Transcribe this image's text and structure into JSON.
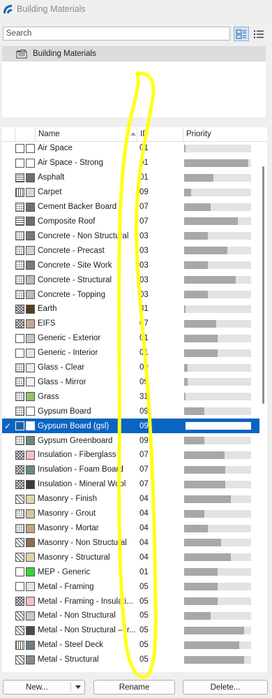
{
  "window": {
    "title": "Building Materials",
    "accent_color": "#0a64c3"
  },
  "search": {
    "placeholder": "Search",
    "value": ""
  },
  "toolbar": {
    "icons": [
      "tree-view-icon",
      "list-view-icon"
    ]
  },
  "tree": {
    "item_label": "Building Materials",
    "icon": "folder-icon"
  },
  "table": {
    "columns": {
      "name": "Name",
      "id": "ID",
      "priority": "Priority"
    },
    "sort": {
      "column": "name",
      "direction": "ascending"
    },
    "rows": [
      {
        "name": "Air Space",
        "id": "01",
        "priority": 0.02,
        "pattern": "none",
        "color": "#ffffff"
      },
      {
        "name": "Air Space - Strong",
        "id": "01",
        "priority": 0.96,
        "pattern": "none",
        "color": "#ffffff"
      },
      {
        "name": "Asphalt",
        "id": "01",
        "priority": 0.44,
        "pattern": "hlines",
        "color": "#6e6e6e"
      },
      {
        "name": "Carpet",
        "id": "09",
        "priority": 0.1,
        "pattern": "vlines",
        "color": "#d8d8d8"
      },
      {
        "name": "Cement Backer Board",
        "id": "07",
        "priority": 0.4,
        "pattern": "dots",
        "color": "#727272"
      },
      {
        "name": "Composite Roof",
        "id": "07",
        "priority": 0.8,
        "pattern": "hlines",
        "color": "#6e6e6e"
      },
      {
        "name": "Concrete - Non Structural",
        "id": "03",
        "priority": 0.35,
        "pattern": "dots",
        "color": "#7a7a7a"
      },
      {
        "name": "Concrete - Precast",
        "id": "03",
        "priority": 0.65,
        "pattern": "dots",
        "color": "#d2d2d2"
      },
      {
        "name": "Concrete - Site Work",
        "id": "03",
        "priority": 0.35,
        "pattern": "dots",
        "color": "#7a7a7a"
      },
      {
        "name": "Concrete - Structural",
        "id": "03",
        "priority": 0.77,
        "pattern": "dots",
        "color": "#bdbdbd"
      },
      {
        "name": "Concrete - Topping",
        "id": "03",
        "priority": 0.35,
        "pattern": "dots",
        "color": "#bdbdbd"
      },
      {
        "name": "Earth",
        "id": "31",
        "priority": 0.02,
        "pattern": "cross",
        "color": "#5a3d1e"
      },
      {
        "name": "EIFS",
        "id": "07",
        "priority": 0.48,
        "pattern": "cross",
        "color": "#c8a890"
      },
      {
        "name": "Generic - Exterior",
        "id": "01",
        "priority": 0.5,
        "pattern": "none",
        "color": "#c8c8c8"
      },
      {
        "name": "Generic - Interior",
        "id": "01",
        "priority": 0.5,
        "pattern": "none",
        "color": "#e6e6e6"
      },
      {
        "name": "Glass - Clear",
        "id": "09",
        "priority": 0.05,
        "pattern": "dots",
        "color": "#e6f2f6"
      },
      {
        "name": "Glass - Mirror",
        "id": "09",
        "priority": 0.05,
        "pattern": "dots",
        "color": "#eef6ee"
      },
      {
        "name": "Grass",
        "id": "31",
        "priority": 0.02,
        "pattern": "dots",
        "color": "#8fc56b"
      },
      {
        "name": "Gypsum Board",
        "id": "09",
        "priority": 0.3,
        "pattern": "dots",
        "color": "#ffffff"
      },
      {
        "name": "Gypsum Board (gsl)",
        "id": "09",
        "priority": 0.02,
        "pattern": "dots",
        "color": "#ffffff",
        "selected": true,
        "checked": true
      },
      {
        "name": "Gypsum Greenboard",
        "id": "09",
        "priority": 0.3,
        "pattern": "dots",
        "color": "#6f8a74"
      },
      {
        "name": "Insulation - Fiberglass",
        "id": "07",
        "priority": 0.6,
        "pattern": "cross",
        "color": "#f4c0c4"
      },
      {
        "name": "Insulation - Foam Board",
        "id": "07",
        "priority": 0.61,
        "pattern": "cross",
        "color": "#6a8a8a"
      },
      {
        "name": "Insulation - Mineral Wool",
        "id": "07",
        "priority": 0.61,
        "pattern": "cross",
        "color": "#3d3a36"
      },
      {
        "name": "Masonry - Finish",
        "id": "04",
        "priority": 0.7,
        "pattern": "diag",
        "color": "#e2d3b0"
      },
      {
        "name": "Masonry - Grout",
        "id": "04",
        "priority": 0.3,
        "pattern": "dots",
        "color": "#d7c7a3"
      },
      {
        "name": "Masonry - Mortar",
        "id": "04",
        "priority": 0.35,
        "pattern": "dots",
        "color": "#bfa98a"
      },
      {
        "name": "Masonry - Non Structural",
        "id": "04",
        "priority": 0.55,
        "pattern": "diag",
        "color": "#8f6a5a"
      },
      {
        "name": "Masonry - Structural",
        "id": "04",
        "priority": 0.7,
        "pattern": "diag",
        "color": "#e2d3b0"
      },
      {
        "name": "MEP - Generic",
        "id": "01",
        "priority": 0.5,
        "pattern": "none",
        "color": "#3cd23c"
      },
      {
        "name": "Metal - Framing",
        "id": "05",
        "priority": 0.5,
        "pattern": "none",
        "color": "#e6e6e6"
      },
      {
        "name": "Metal - Framing - Insulati...",
        "id": "05",
        "priority": 0.5,
        "pattern": "cross",
        "color": "#f4c0c4"
      },
      {
        "name": "Metal - Non Structural",
        "id": "05",
        "priority": 0.4,
        "pattern": "diag",
        "color": "#c8c8c8"
      },
      {
        "name": "Metal - Non Structural – Ir...",
        "id": "05",
        "priority": 0.9,
        "pattern": "diag",
        "color": "#4a4a4a"
      },
      {
        "name": "Metal - Steel Deck",
        "id": "05",
        "priority": 0.82,
        "pattern": "vlines",
        "color": "#6e7d86"
      },
      {
        "name": "Metal - Structural",
        "id": "05",
        "priority": 0.9,
        "pattern": "diag",
        "color": "#8a8a8a"
      }
    ]
  },
  "buttons": {
    "new": "New...",
    "rename": "Rename",
    "delete": "Delete..."
  },
  "annotation": {
    "color": "#ffff1a"
  }
}
